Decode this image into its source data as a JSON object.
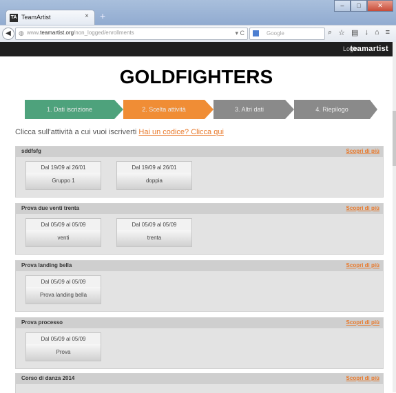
{
  "browser": {
    "tab_title": "TeamArtist",
    "tab_favicon": "TA",
    "tab_close": "×",
    "new_tab": "+",
    "url_prefix": "www.",
    "url_host": "teamartist.org",
    "url_path": "/non_logged/enrollments",
    "url_tools": "▾ C",
    "search_placeholder": "Google",
    "window_buttons": [
      "–",
      "□",
      "✕"
    ]
  },
  "site": {
    "login_label": "Login",
    "logo_text": "teamartist"
  },
  "page": {
    "title": "GOLDFIGHTERS",
    "steps": [
      {
        "label": "1. Dati iscrizione",
        "color": "#4ea27c",
        "state": "done"
      },
      {
        "label": "2. Scelta attività",
        "color": "#f08d35",
        "state": "current"
      },
      {
        "label": "3. Altri dati",
        "color": "#8a8a8a",
        "state": "todo"
      },
      {
        "label": "4. Riepilogo",
        "color": "#8a8a8a",
        "state": "todo"
      }
    ],
    "intro_text": "Clicca sull'attività a cui vuoi iscriverti",
    "code_link": "Hai un codice? Clicca qui",
    "more_label": "Scopri di più",
    "activities": [
      {
        "name": "sddfsfg",
        "slots": [
          {
            "dates": "Dal 19/09 al 26/01",
            "name": "Gruppo 1"
          },
          {
            "dates": "Dal 19/09 al 26/01",
            "name": "doppia"
          }
        ]
      },
      {
        "name": "Prova due venti trenta",
        "slots": [
          {
            "dates": "Dal 05/09 al 05/09",
            "name": "venti"
          },
          {
            "dates": "Dal 05/09 al 05/09",
            "name": "trenta"
          }
        ]
      },
      {
        "name": "Prova landing bella",
        "slots": [
          {
            "dates": "Dal 05/09 al 05/09",
            "name": "Prova landing bella"
          }
        ]
      },
      {
        "name": "Prova processo",
        "slots": [
          {
            "dates": "Dal 05/09 al 05/09",
            "name": "Prova"
          }
        ]
      },
      {
        "name": "Corso di danza 2014",
        "slots": []
      }
    ]
  },
  "colors": {
    "accent": "#e8792b",
    "sitebar": "#1f1f1f"
  }
}
